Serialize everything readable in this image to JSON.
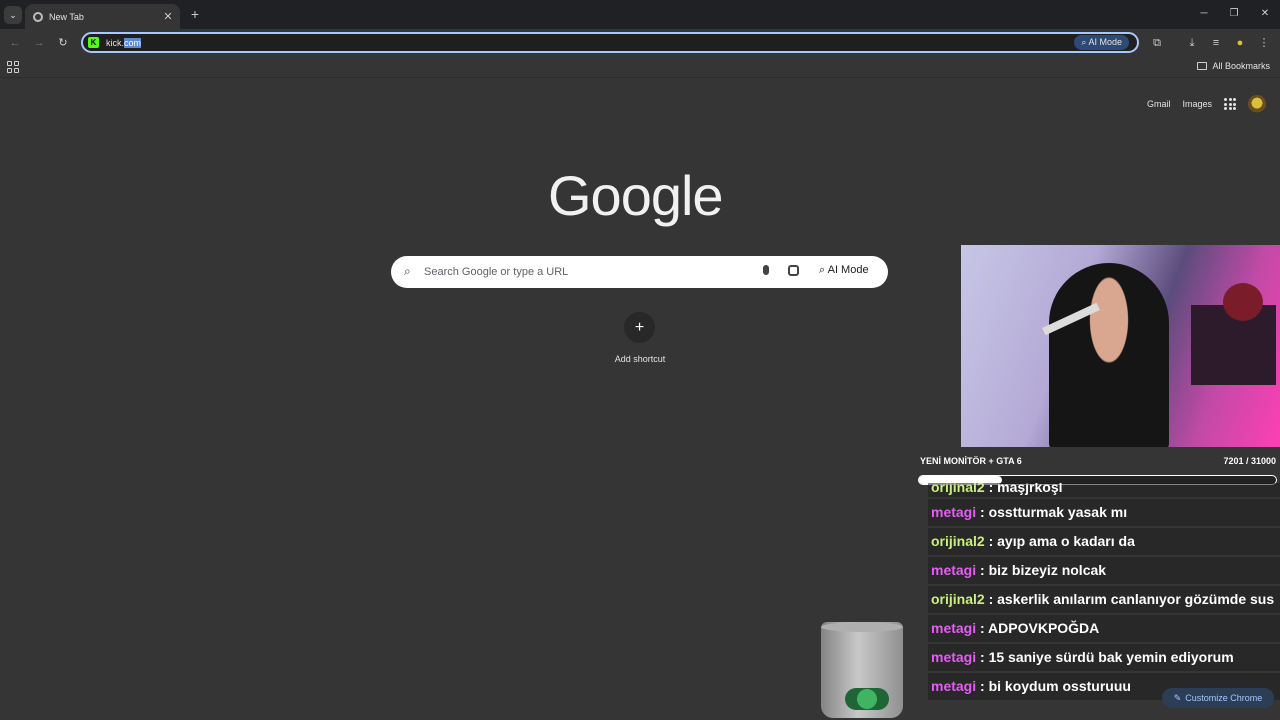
{
  "tabs": [
    {
      "title": "New Tab"
    }
  ],
  "toolbar": {
    "url_before": "kick.",
    "url_selected": "com",
    "ai_mode_label": "AI Mode"
  },
  "bookmarks": {
    "all_label": "All Bookmarks"
  },
  "ntp": {
    "gmail": "Gmail",
    "images": "Images",
    "logo": "Google",
    "search_placeholder": "Search Google or type a URL",
    "ai_mode_label": "AI Mode",
    "add_shortcut": "Add shortcut",
    "customize": "Customize Chrome"
  },
  "stream": {
    "goal_title": "YENİ MONİTÖR + GTA 6",
    "goal_count": "7201 / 31000",
    "goal_progress": 0.232,
    "chat": [
      {
        "user": "orijinal2",
        "text": "maşjrkoşl",
        "color": "#c9f07a",
        "partial": true
      },
      {
        "user": "metagi",
        "text": "osstturmak yasak mı",
        "color": "#e55cf5"
      },
      {
        "user": "orijinal2",
        "text": "ayıp ama o kadarı da",
        "color": "#c9f07a"
      },
      {
        "user": "metagi",
        "text": "biz bizeyiz nolcak",
        "color": "#e55cf5"
      },
      {
        "user": "orijinal2",
        "text": "askerlik anılarım canlanıyor gözümde sus",
        "color": "#c9f07a"
      },
      {
        "user": "metagi",
        "text": "ADPOVKPOĞDA",
        "color": "#e55cf5"
      },
      {
        "user": "metagi",
        "text": "15 saniye sürdü bak yemin ediyorum",
        "color": "#e55cf5"
      },
      {
        "user": "metagi",
        "text": "bi koydum ossturuuu",
        "color": "#e55cf5"
      }
    ]
  },
  "colors": {
    "accent": "#a8c7fa",
    "kick_green": "#53fc18"
  }
}
